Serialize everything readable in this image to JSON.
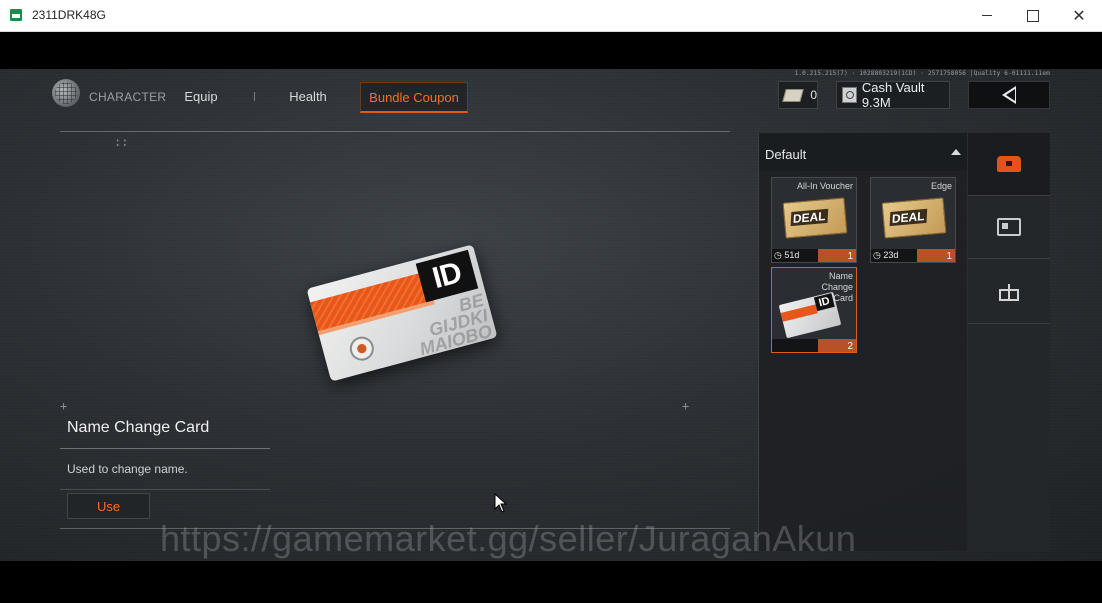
{
  "window": {
    "title": "2311DRK48G",
    "minimize_icon": "minimize-icon",
    "maximize_icon": "maximize-icon",
    "close_icon": "close-icon"
  },
  "header": {
    "section": "CHARACTER",
    "tabs": [
      {
        "label": "Equip",
        "active": false
      },
      {
        "label": "Health",
        "active": false
      },
      {
        "label": "Bundle Coupon",
        "active": true
      }
    ],
    "cash_count": "0",
    "cash_vault_label": "Cash Vault 9.3M",
    "debug_info": "1.0.215.215(7) · 1028803219(1CD) · 2571758056 |Quality 6-01111.11em"
  },
  "item_detail": {
    "name": "Name Change Card",
    "description": "Used to change name.",
    "use_label": "Use",
    "card_id_text": "ID",
    "card_watermark_text": "BE GIJDKI MAIOBO"
  },
  "inventory": {
    "title": "Default",
    "items": [
      {
        "label": "All-In Voucher",
        "badge": "DEAL",
        "timer": "51d",
        "count": "1",
        "selected": false
      },
      {
        "label": "Edge",
        "badge": "DEAL",
        "timer": "23d",
        "count": "1",
        "selected": false
      },
      {
        "label": "Name Change Card",
        "count": "2",
        "selected": true
      }
    ]
  },
  "categories": [
    {
      "icon": "chest-icon",
      "active": true
    },
    {
      "icon": "card-icon",
      "active": false
    },
    {
      "icon": "gift-icon",
      "active": false
    }
  ],
  "watermark": "https://gamemarket.gg/seller/JuraganAkun",
  "colors": {
    "accent": "#e05a1c",
    "accent_text": "#ff6a2a",
    "panel": "#1e2124"
  }
}
